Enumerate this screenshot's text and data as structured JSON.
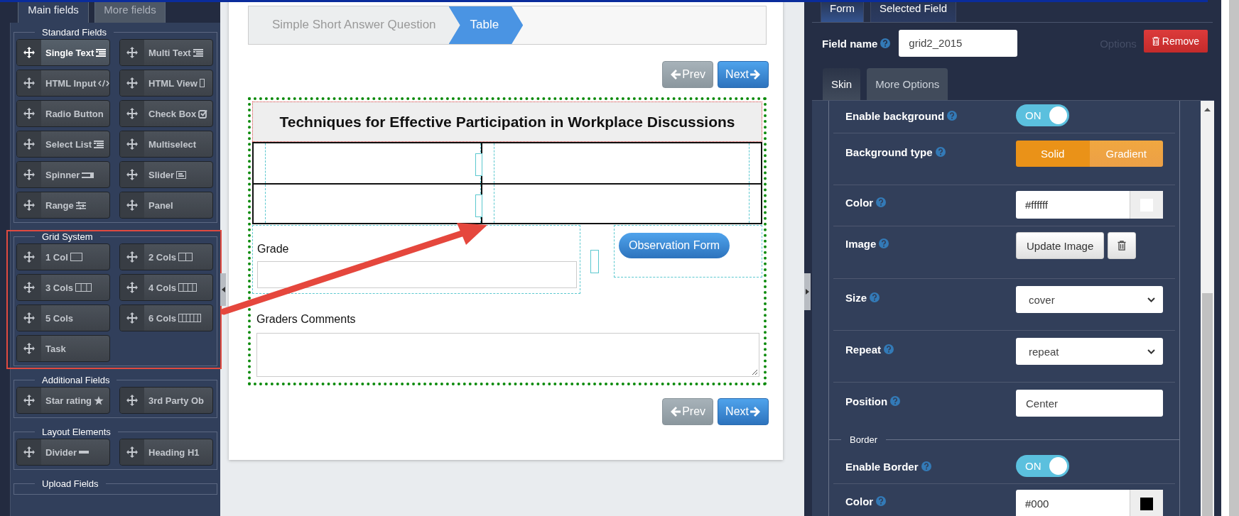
{
  "left_panel": {
    "tabs": [
      {
        "label": "Main fields",
        "selected": true
      },
      {
        "label": "More fields",
        "selected": false
      }
    ],
    "groups": [
      {
        "legend": "Standard Fields",
        "highlighted": false,
        "items": [
          {
            "label": "Single Text",
            "kind": "list",
            "selected": true
          },
          {
            "label": "Multi Text",
            "kind": "list",
            "selected": false
          },
          {
            "label": "HTML Input",
            "kind": "code",
            "selected": false
          },
          {
            "label": "HTML View",
            "kind": "frame",
            "selected": false
          },
          {
            "label": "Radio Button",
            "selected": false
          },
          {
            "label": "Check Box",
            "kind": "check",
            "selected": false
          },
          {
            "label": "Select List",
            "kind": "list",
            "selected": false
          },
          {
            "label": "Multiselect",
            "selected": false
          },
          {
            "label": "Spinner",
            "kind": "spinner",
            "selected": false
          },
          {
            "label": "Slider",
            "kind": "slider",
            "selected": false
          },
          {
            "label": "Range",
            "kind": "range",
            "selected": false
          },
          {
            "label": "Panel",
            "selected": false
          }
        ]
      },
      {
        "legend": "Grid System",
        "highlighted": true,
        "items": [
          {
            "label": "1 Col",
            "kind": "col1",
            "selected": false
          },
          {
            "label": "2 Cols",
            "kind": "col2",
            "selected": false
          },
          {
            "label": "3 Cols",
            "kind": "col3",
            "selected": false
          },
          {
            "label": "4 Cols",
            "kind": "col4",
            "selected": false
          },
          {
            "label": "5 Cols",
            "selected": false
          },
          {
            "label": "6 Cols",
            "kind": "col6",
            "selected": false
          },
          {
            "label": "Task",
            "selected": false
          }
        ]
      },
      {
        "legend": "Additional Fields",
        "highlighted": false,
        "items": [
          {
            "label": "Star rating",
            "kind": "star",
            "selected": false
          },
          {
            "label": "3rd Party Ob",
            "selected": false
          }
        ]
      },
      {
        "legend": "Layout Elements",
        "highlighted": false,
        "items": [
          {
            "label": "Divider",
            "kind": "dash",
            "selected": false
          },
          {
            "label": "Heading H1",
            "selected": false
          }
        ]
      },
      {
        "legend": "Upload Fields",
        "highlighted": false
      }
    ]
  },
  "canvas": {
    "steps": [
      {
        "label": "Simple Short Answer Question",
        "selected": false
      },
      {
        "label": "Table",
        "selected": true
      }
    ],
    "nav_top": {
      "prev": "Prev",
      "next": "Next"
    },
    "heading": "Techniques for Effective Participation in Workplace Discussions",
    "grade": {
      "label": "Grade"
    },
    "observation_button": "Observation Form",
    "comments": {
      "label": "Graders Comments"
    },
    "nav_bottom": {
      "prev": "Prev",
      "next": "Next"
    }
  },
  "right_panel": {
    "tabs": [
      {
        "label": "Form",
        "selected": true
      },
      {
        "label": "Selected Field",
        "selected": false
      }
    ],
    "field_name": {
      "label": "Field name",
      "value": "grid2_2015"
    },
    "options_label": "Options",
    "remove_button": "Remove",
    "subtabs": [
      {
        "label": "Skin",
        "selected": true
      },
      {
        "label": "More Options",
        "selected": false
      }
    ],
    "background_rows": [
      {
        "kind": "toggle",
        "label": "Enable background",
        "on": true,
        "text": "ON"
      },
      {
        "kind": "segmented",
        "label": "Background type",
        "options": [
          {
            "label": "Solid",
            "selected": true
          },
          {
            "label": "Gradient",
            "selected": false
          }
        ]
      },
      {
        "kind": "color",
        "label": "Color",
        "value": "#ffffff",
        "color": "#ffffff"
      },
      {
        "kind": "image",
        "label": "Image",
        "button": "Update Image"
      },
      {
        "kind": "select",
        "label": "Size",
        "value": "cover"
      },
      {
        "kind": "select",
        "label": "Repeat",
        "value": "repeat"
      },
      {
        "kind": "input",
        "label": "Position",
        "value": "Center"
      }
    ],
    "border": {
      "legend": "Border",
      "rows": [
        {
          "kind": "toggle",
          "label": "Enable Border",
          "on": true,
          "text": "ON"
        },
        {
          "kind": "color",
          "label": "Color",
          "value": "#000",
          "color": "#000000"
        }
      ]
    }
  }
}
